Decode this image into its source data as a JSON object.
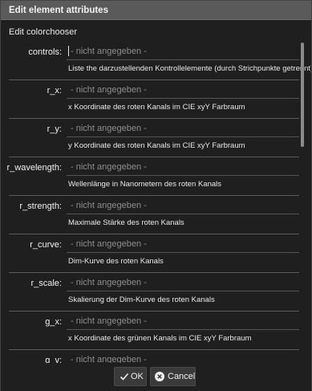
{
  "dialog": {
    "title": "Edit element attributes",
    "subtitle": "Edit colorchooser"
  },
  "fields": [
    {
      "label": "controls:",
      "placeholder": "- nicht angegeben -",
      "description": "Liste the darzustellenden Kontrollelemente (durch Strichpunkte getrennt)"
    },
    {
      "label": "r_x:",
      "placeholder": "- nicht angegeben -",
      "description": "x Koordinate des roten Kanals im CIE xyY Farbraum"
    },
    {
      "label": "r_y:",
      "placeholder": "- nicht angegeben -",
      "description": "y Koordinate des roten Kanals im CIE xyY Farbraum"
    },
    {
      "label": "r_wavelength:",
      "placeholder": "- nicht angegeben -",
      "description": "Wellenlänge in Nanometern des roten Kanals"
    },
    {
      "label": "r_strength:",
      "placeholder": "- nicht angegeben -",
      "description": "Maximale Stärke des roten Kanals"
    },
    {
      "label": "r_curve:",
      "placeholder": "- nicht angegeben -",
      "description": "Dim-Kurve des roten Kanals"
    },
    {
      "label": "r_scale:",
      "placeholder": "- nicht angegeben -",
      "description": "Skalierung der Dim-Kurve des roten Kanals"
    },
    {
      "label": "g_x:",
      "placeholder": "- nicht angegeben -",
      "description": "x Koordinate des grünen Kanals im CIE xyY Farbraum"
    },
    {
      "label": "g_y:",
      "placeholder": "- nicht angegeben -",
      "description": ""
    }
  ],
  "buttons": {
    "ok_label": "OK",
    "cancel_label": "Cancel"
  }
}
